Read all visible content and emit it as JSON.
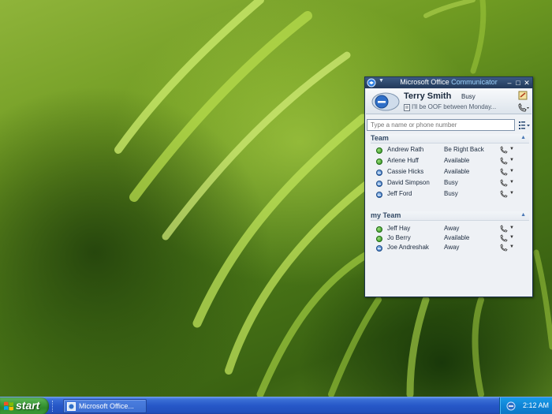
{
  "window": {
    "title_prefix": "Microsoft Office",
    "title_accent": "Communicator"
  },
  "profile": {
    "name": "Terry Smith",
    "status": "Busy",
    "note": "I'll be OOF between Monday..."
  },
  "search": {
    "placeholder": "Type a name or phone number"
  },
  "groups": [
    {
      "name": "Team",
      "contacts": [
        {
          "name": "Andrew Rath",
          "status": "Be Right Back",
          "presence": "green"
        },
        {
          "name": "Arlene Huff",
          "status": "Available",
          "presence": "green"
        },
        {
          "name": "Cassie Hicks",
          "status": "Available",
          "presence": "blue"
        },
        {
          "name": "David Simpson",
          "status": "Busy",
          "presence": "blue"
        },
        {
          "name": "Jeff Ford",
          "status": "Busy",
          "presence": "blue"
        }
      ]
    },
    {
      "name": "my Team",
      "contacts": [
        {
          "name": "Jeff Hay",
          "status": "Away",
          "presence": "green"
        },
        {
          "name": "Jo Berry",
          "status": "Available",
          "presence": "green"
        },
        {
          "name": "Joe Andreshak",
          "status": "Away",
          "presence": "blue"
        }
      ]
    }
  ],
  "taskbar": {
    "start_label": "start",
    "task_label": "Microsoft Office...",
    "clock": "2:12 AM"
  },
  "colors": {
    "presence_green": "#2a8c1a",
    "presence_blue": "#2b66b3",
    "taskbar_blue": "#2657c7",
    "start_green": "#3c9a38"
  }
}
